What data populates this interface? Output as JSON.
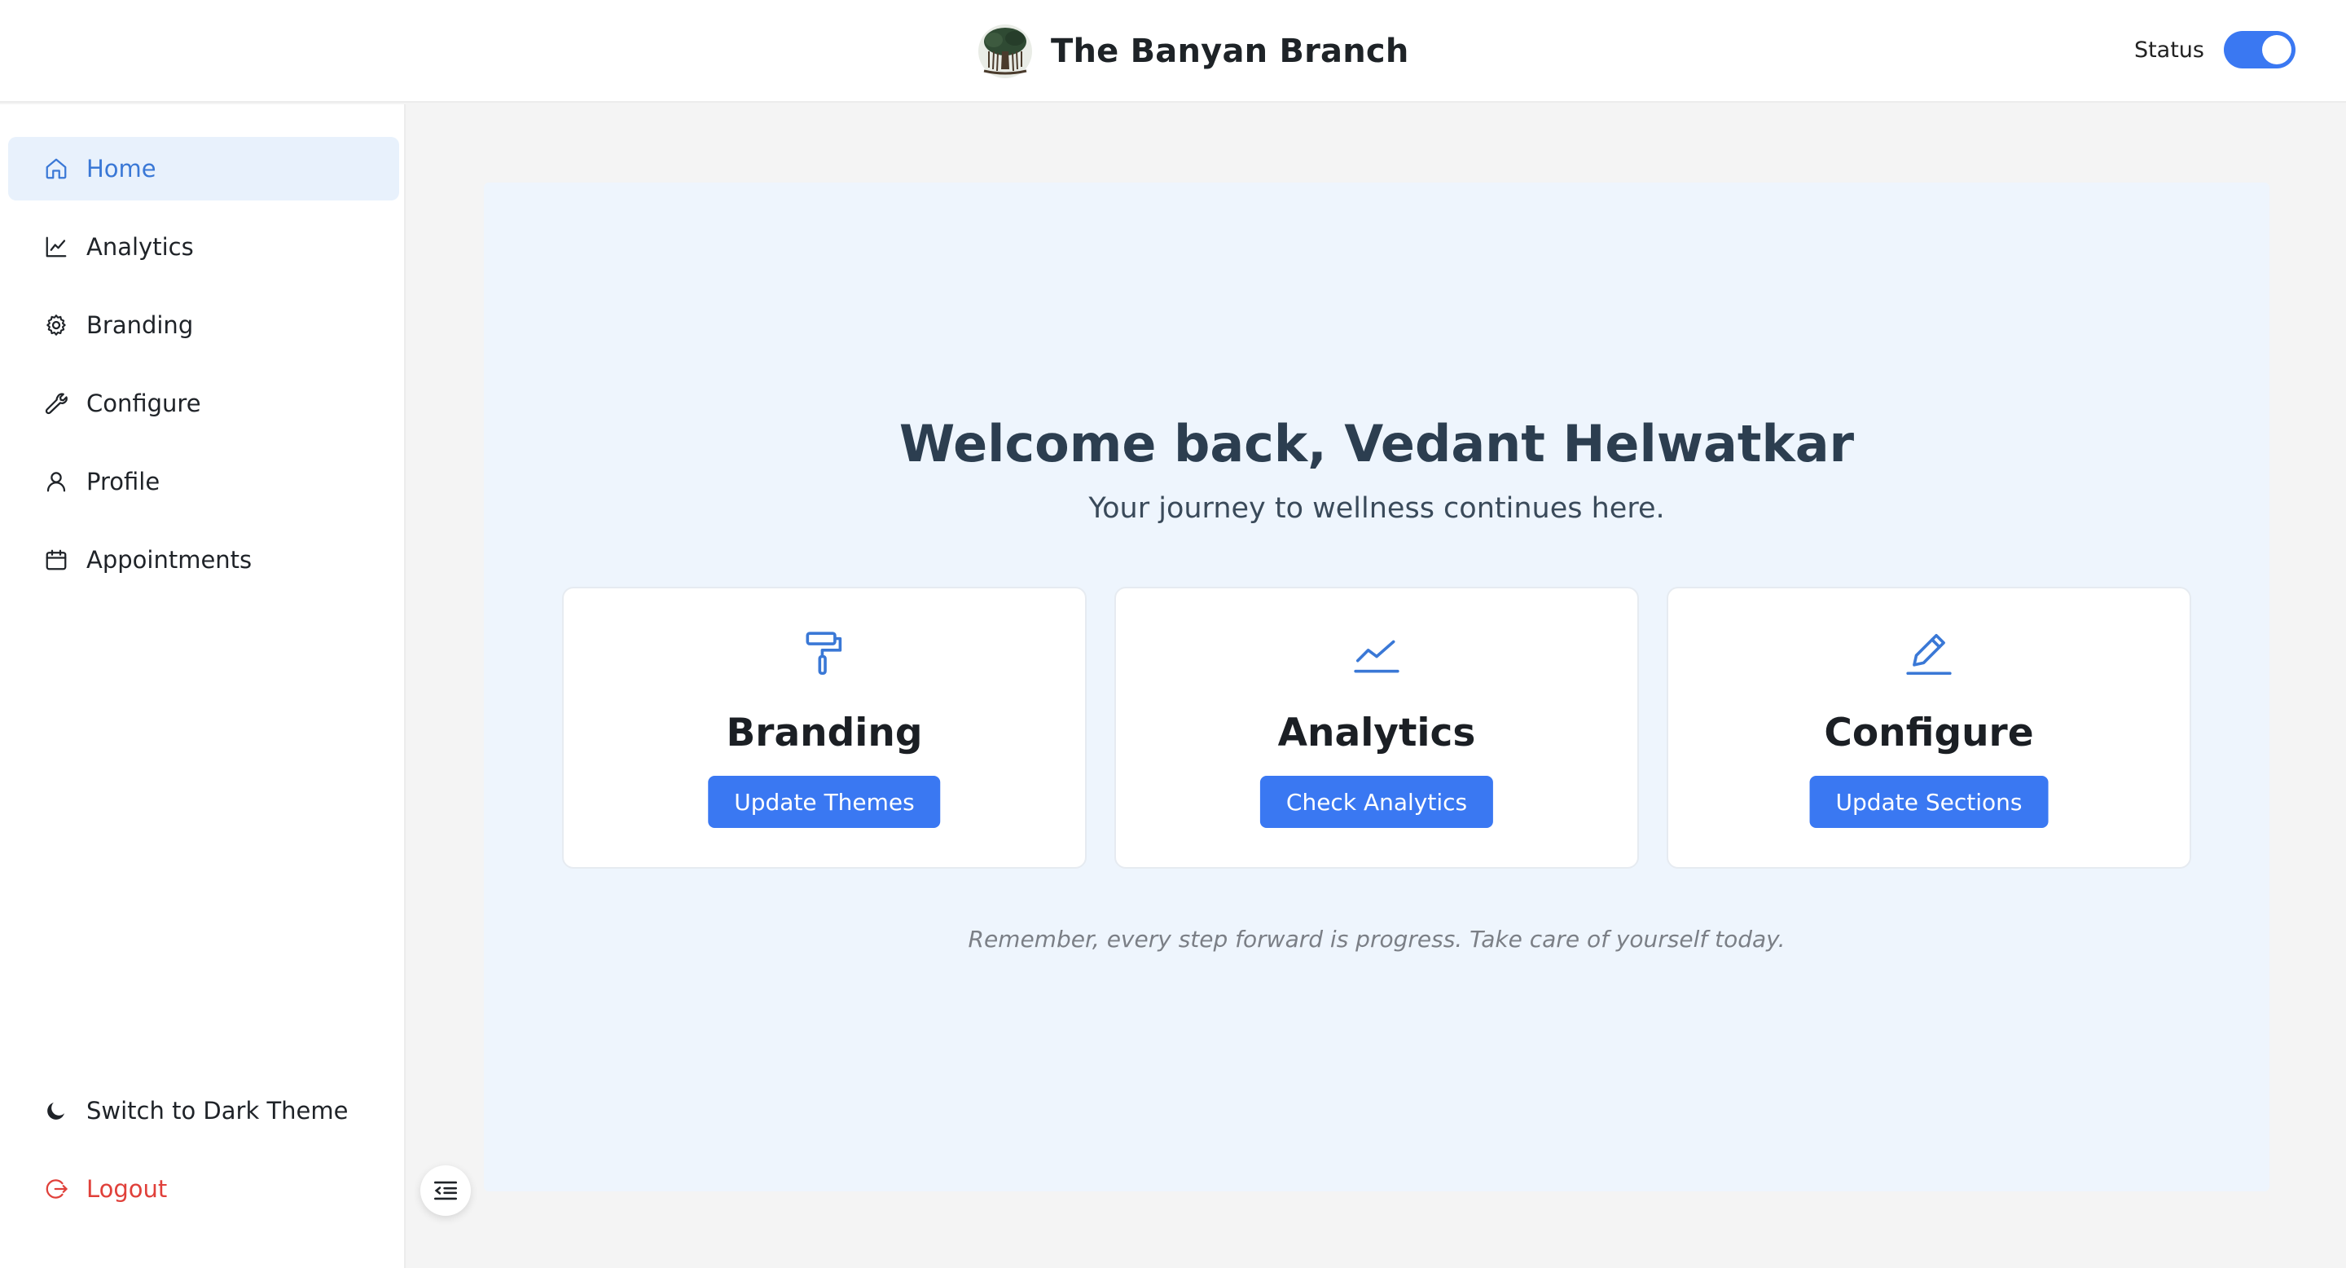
{
  "header": {
    "brand_name": "The Banyan Branch",
    "status_label": "Status",
    "status_on": true
  },
  "sidebar": {
    "items": [
      {
        "label": "Home",
        "icon": "home-icon",
        "active": true
      },
      {
        "label": "Analytics",
        "icon": "chart-line-icon"
      },
      {
        "label": "Branding",
        "icon": "gear-icon"
      },
      {
        "label": "Configure",
        "icon": "wrench-icon"
      },
      {
        "label": "Profile",
        "icon": "user-icon"
      },
      {
        "label": "Appointments",
        "icon": "calendar-icon"
      }
    ],
    "theme_toggle_label": "Switch to Dark Theme",
    "logout_label": "Logout"
  },
  "main": {
    "welcome": "Welcome back, Vedant Helwatkar",
    "subtitle": "Your journey to wellness continues here.",
    "cards": [
      {
        "title": "Branding",
        "button": "Update Themes",
        "icon": "paint-roller-icon"
      },
      {
        "title": "Analytics",
        "button": "Check Analytics",
        "icon": "trend-line-icon"
      },
      {
        "title": "Configure",
        "button": "Update Sections",
        "icon": "pencil-icon"
      }
    ],
    "quote": "Remember, every step forward is progress. Take care of yourself today."
  },
  "colors": {
    "accent": "#3a78f2",
    "active_nav_bg": "#e8f1fc",
    "active_nav_text": "#3a78d6",
    "logout": "#e0403a",
    "panel_bg": "#eef5fd",
    "page_bg": "#f4f4f4"
  }
}
